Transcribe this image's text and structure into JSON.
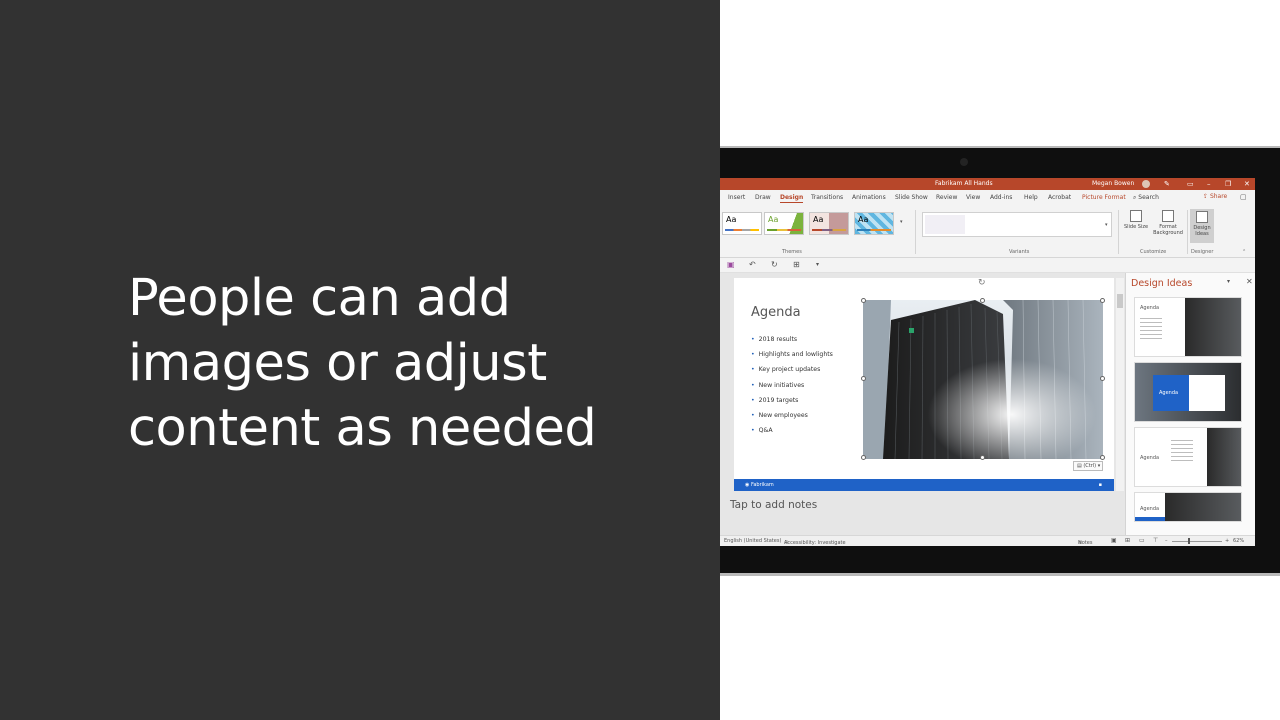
{
  "headline": [
    "People can add",
    "images or adjust",
    "content as needed"
  ],
  "window": {
    "title": "Fabrikam All Hands",
    "user": "Megan Bowen",
    "accent": "#b7472a"
  },
  "ribbon_tabs": [
    "Insert",
    "Draw",
    "Design",
    "Transitions",
    "Animations",
    "Slide Show",
    "Review",
    "View",
    "Add-ins",
    "Help",
    "Acrobat",
    "Picture Format"
  ],
  "active_tab": "Design",
  "search_label": "Search",
  "share_label": "Share",
  "ribbon": {
    "themes_label": "Themes",
    "variants_label": "Variants",
    "customize_label": "Customize",
    "designer_label": "Designer",
    "theme_tiles": [
      "Aa",
      "Aa",
      "Aa",
      "Aa"
    ],
    "slide_size": "Slide Size",
    "format_background": "Format Background",
    "design_ideas": "Design Ideas"
  },
  "slide": {
    "title": "Agenda",
    "bullets": [
      "2018 results",
      "Highlights and lowlights",
      "Key project updates",
      "New initiatives",
      "2019 targets",
      "New employees",
      "Q&A"
    ],
    "footer_brand": "Fabrikam",
    "paste_option": "(Ctrl)",
    "brand_color": "#1f62c7"
  },
  "notes_placeholder": "Tap to add notes",
  "design_pane": {
    "title": "Design Ideas",
    "idea_label": "Agenda"
  },
  "statusbar": {
    "language": "English (United States)",
    "accessibility": "Accessibility: Investigate",
    "notes": "Notes",
    "zoom": "62%"
  }
}
